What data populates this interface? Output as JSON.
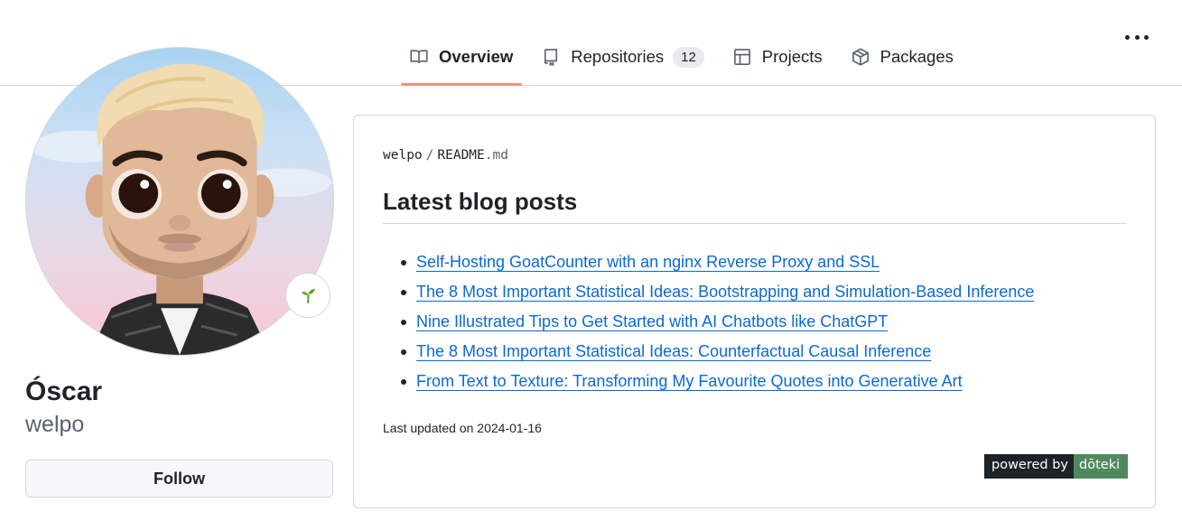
{
  "tabs": [
    {
      "label": "Overview",
      "icon": "book-icon",
      "active": true
    },
    {
      "label": "Repositories",
      "icon": "repo-icon",
      "count": "12"
    },
    {
      "label": "Projects",
      "icon": "table-icon"
    },
    {
      "label": "Packages",
      "icon": "package-icon"
    }
  ],
  "more_menu": {
    "icon": "kebab-horizontal-icon"
  },
  "profile": {
    "avatar_alt": "Cartoon avatar of Óscar",
    "status_emoji": "seedling-icon",
    "full_name": "Óscar",
    "username": "welpo",
    "follow_label": "Follow"
  },
  "readme": {
    "owner": "welpo",
    "separator": "/",
    "file_base": "README",
    "file_ext": ".md",
    "heading": "Latest blog posts",
    "posts": [
      "Self-Hosting GoatCounter with an nginx Reverse Proxy and SSL",
      "The 8 Most Important Statistical Ideas: Bootstrapping and Simulation-Based Inference",
      "Nine Illustrated Tips to Get Started with AI Chatbots like ChatGPT",
      "The 8 Most Important Statistical Ideas: Counterfactual Causal Inference",
      "From Text to Texture: Transforming My Favourite Quotes into Generative Art"
    ],
    "last_updated": "Last updated on 2024-01-16",
    "badge": {
      "left": "powered by",
      "right": "dōteki"
    }
  },
  "colors": {
    "accent_underline": "#fd8c73",
    "link": "#0969da",
    "badge_right": "#4f8a5f",
    "badge_left": "#1d2326"
  }
}
